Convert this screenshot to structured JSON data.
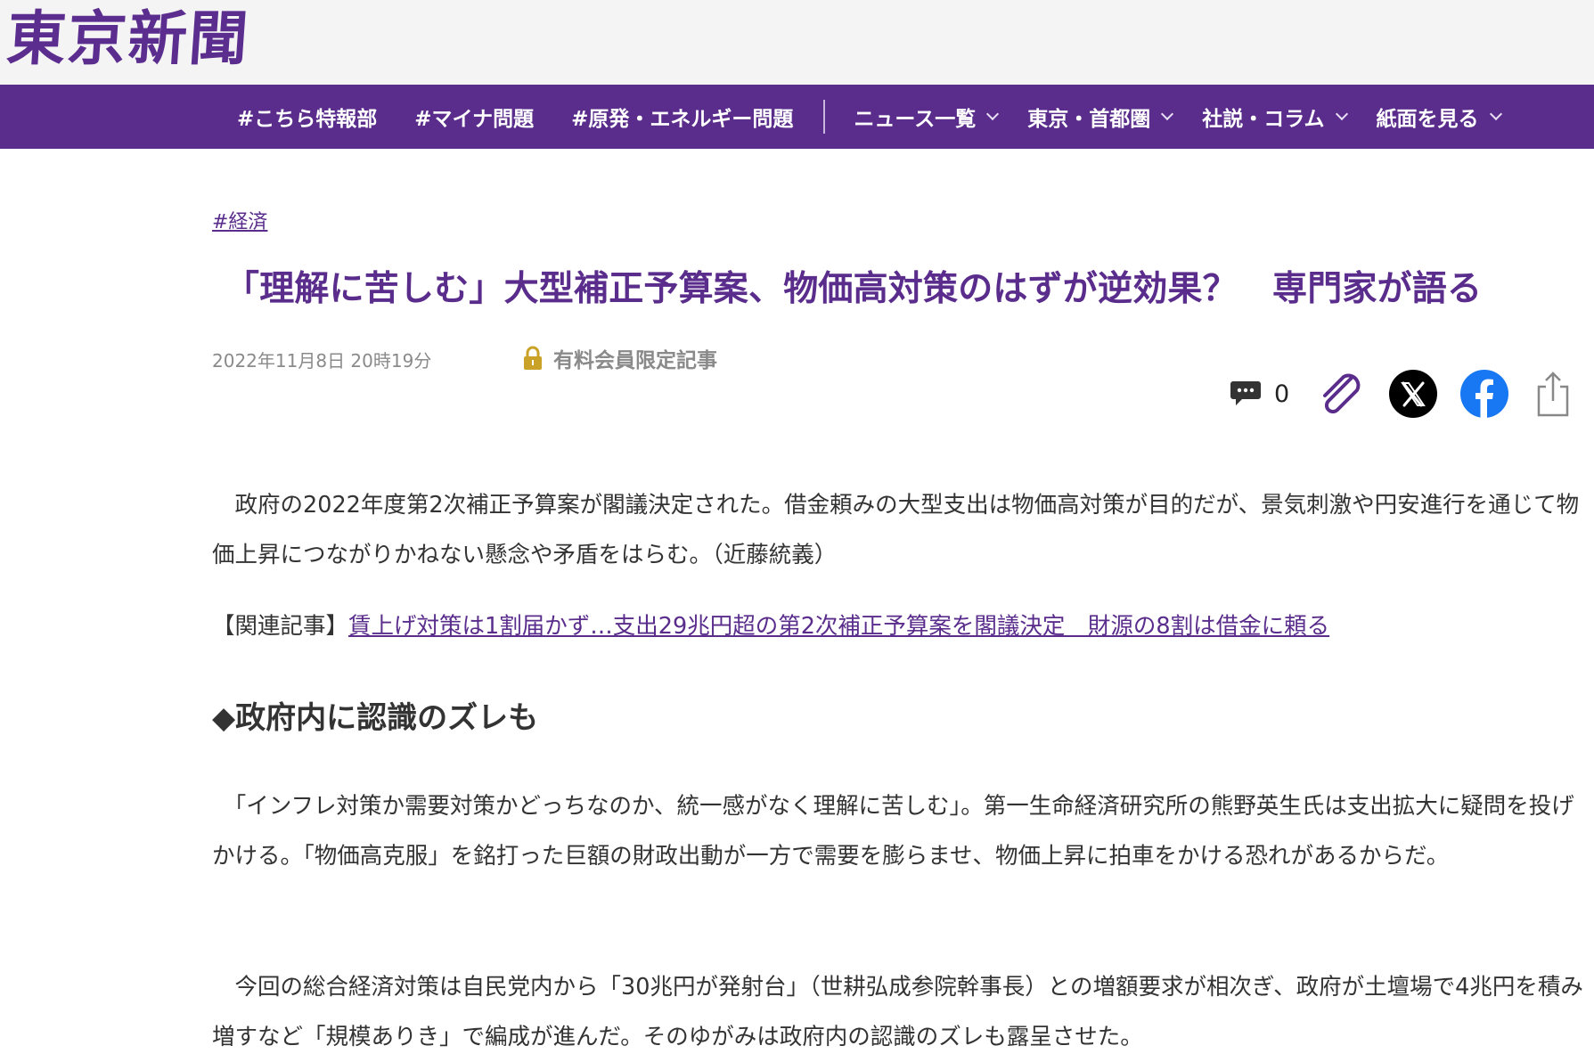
{
  "header": {
    "logo_text": "東京新聞"
  },
  "nav": {
    "items": [
      {
        "label": "#こちら特報部",
        "has_dropdown": false
      },
      {
        "label": "#マイナ問題",
        "has_dropdown": false
      },
      {
        "label": "#原発・エネルギー問題",
        "has_dropdown": false
      },
      {
        "label": "ニュース一覧",
        "has_dropdown": true
      },
      {
        "label": "東京・首都圏",
        "has_dropdown": true
      },
      {
        "label": "社説・コラム",
        "has_dropdown": true
      },
      {
        "label": "紙面を見る",
        "has_dropdown": true
      }
    ]
  },
  "article": {
    "tag": "#経済",
    "title": "「理解に苦しむ」大型補正予算案、物価高対策のはずが逆効果？　専門家が語る",
    "date": "2022年11月8日 20時19分",
    "premium_label": "有料会員限定記事",
    "comment_count": "0",
    "lead": "　政府の2022年度第2次補正予算案が閣議決定された。借金頼みの大型支出は物価高対策が目的だが、景気刺激や円安進行を通じて物価上昇につながりかねない懸念や矛盾をはらむ。（近藤統義）",
    "related_prefix": "【関連記事】",
    "related_link": "賃上げ対策は1割届かず…支出29兆円超の第2次補正予算案を閣議決定　財源の8割は借金に頼る",
    "subheading": "◆政府内に認識のズレも",
    "para1": "　「インフレ対策か需要対策かどっちなのか、統一感がなく理解に苦しむ」。第一生命経済研究所の熊野英生氏は支出拡大に疑問を投げかける。「物価高克服」を銘打った巨額の財政出動が一方で需要を膨らませ、物価上昇に拍車をかける恐れがあるからだ。",
    "para2": "　今回の総合経済対策は自民党内から「30兆円が発射台」（世耕弘成参院幹事長）との増額要求が相次ぎ、政府が土壇場で4兆円を積み増すなど「規模ありき」で編成が進んだ。そのゆがみは政府内の認識のズレも露呈させた。"
  },
  "colors": {
    "brand": "#5a2d8c",
    "lock": "#c9a227"
  },
  "icons": [
    "lock-icon",
    "comment-icon",
    "clip-icon",
    "x-icon",
    "facebook-icon",
    "share-icon",
    "chevron-down-icon"
  ]
}
